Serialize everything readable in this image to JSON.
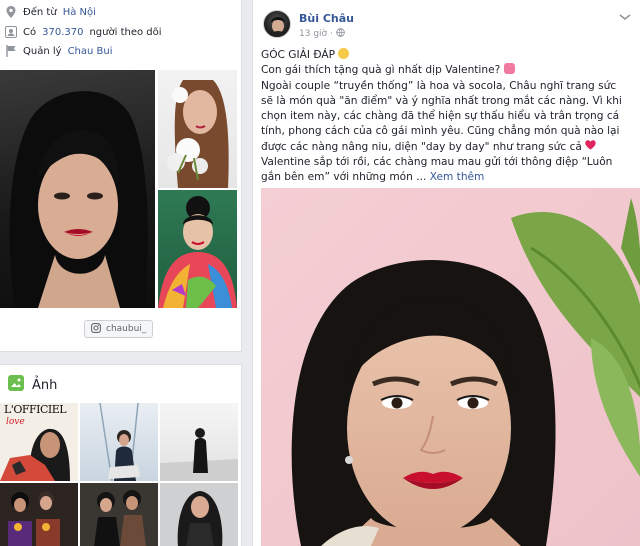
{
  "intro": {
    "from_prefix": "Đến từ",
    "from_place": "Hà Nội",
    "followers_prefix": "Có",
    "followers_count": "370.370",
    "followers_suffix": "người theo dõi",
    "managed_prefix": "Quản lý",
    "managed_name": "Chau Bui",
    "instagram_handle": "chaubui_"
  },
  "photos": {
    "title": "Ảnh",
    "magazine_text": "L'OFFICIEL",
    "magazine_sub": "love"
  },
  "post": {
    "author": "Bùi Châu",
    "time": "13 giờ",
    "line_heading": "GÓC GIẢI ĐÁP",
    "line_question": "Con gái thích tặng quà gì nhất dịp Valentine?",
    "paragraph": "Ngoài couple “truyền thống” là hoa và socola, Châu nghĩ trang sức sẽ là món quà \"ăn điểm\" và ý nghĩa nhất trong mắt các nàng. Vì khi chọn item này, các chàng đã thể hiện sự thấu hiểu và trân trọng cá tính, phong cách của cô gái mình yêu. Cũng chẳng món quà nào lại được các nàng nâng niu, diện \"day by day\" như trang sức cả",
    "closing": "Valentine sắp tới rồi, các chàng mau mau gửi tới thông điệp “Luôn gắn bên em” với những món ...",
    "see_more": "Xem thêm"
  },
  "colors": {
    "link": "#365899",
    "page_bg": "#e9ebee",
    "card_bg": "#ffffff",
    "lip_red": "#c8102e",
    "heart": "#e0245e"
  }
}
